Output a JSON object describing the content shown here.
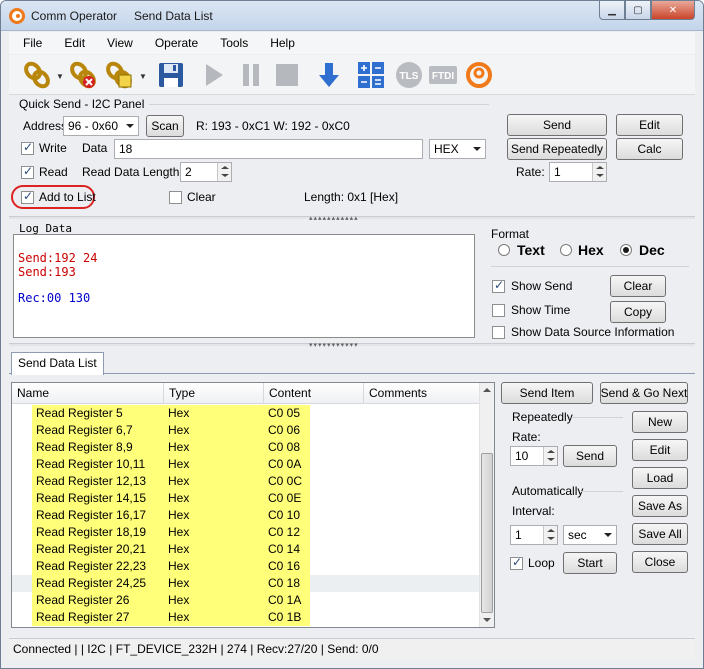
{
  "window": {
    "app_title": "Comm Operator",
    "doc_title": "Send Data List"
  },
  "menu": [
    "File",
    "Edit",
    "View",
    "Operate",
    "Tools",
    "Help"
  ],
  "toolbar": {
    "tls_label": "TLS",
    "ftdi_label": "FTDI"
  },
  "quick_send": {
    "group_title": "Quick Send - I2C Panel",
    "address_label": "Address",
    "address_value": "96 - 0x60",
    "scan_label": "Scan",
    "read_write_info": "R: 193 - 0xC1  W: 192 - 0xC0",
    "write_label": "Write",
    "data_label": "Data",
    "data_value": "18",
    "format_value": "HEX",
    "read_label": "Read",
    "read_length_label": "Read Data Length",
    "read_length_value": "2",
    "add_to_list_label": "Add to List",
    "clear_label": "Clear",
    "length_info": "Length: 0x1 [Hex]",
    "send_label": "Send",
    "send_repeatedly_label": "Send Repeatedly",
    "rate_label": "Rate:",
    "rate_value": "1",
    "edit_label": "Edit",
    "calc_label": "Calc",
    "write_checked": true,
    "read_checked": true,
    "add_to_list_checked": true,
    "clear_checked": false
  },
  "log": {
    "title": "Log Data",
    "lines": [
      {
        "text": "Send:192 24",
        "color": "#cc0000"
      },
      {
        "text": "Send:193",
        "color": "#cc0000"
      },
      {
        "text": "",
        "color": "#000000"
      },
      {
        "text": "Rec:00 130",
        "color": "#0000cc"
      }
    ]
  },
  "format": {
    "title": "Format",
    "options": [
      "Text",
      "Hex",
      "Dec"
    ],
    "selected": "Dec",
    "show_send_label": "Show Send",
    "show_time_label": "Show Time",
    "show_source_label": "Show Data Source Information",
    "clear_label": "Clear",
    "copy_label": "Copy"
  },
  "send_list": {
    "tab_label": "Send Data List",
    "columns": [
      "Name",
      "Type",
      "Content",
      "Comments"
    ],
    "rows": [
      {
        "name": "Read Register 5",
        "type": "Hex",
        "content": "C0 05",
        "comments": ""
      },
      {
        "name": "Read Register 6,7",
        "type": "Hex",
        "content": "C0 06",
        "comments": ""
      },
      {
        "name": "Read Register 8,9",
        "type": "Hex",
        "content": "C0 08",
        "comments": ""
      },
      {
        "name": "Read Register 10,11",
        "type": "Hex",
        "content": "C0 0A",
        "comments": ""
      },
      {
        "name": "Read Register 12,13",
        "type": "Hex",
        "content": "C0 0C",
        "comments": ""
      },
      {
        "name": "Read Register 14,15",
        "type": "Hex",
        "content": "C0 0E",
        "comments": ""
      },
      {
        "name": "Read Register 16,17",
        "type": "Hex",
        "content": "C0 10",
        "comments": ""
      },
      {
        "name": "Read Register 18,19",
        "type": "Hex",
        "content": "C0 12",
        "comments": ""
      },
      {
        "name": "Read Register 20,21",
        "type": "Hex",
        "content": "C0 14",
        "comments": ""
      },
      {
        "name": "Read Register 22,23",
        "type": "Hex",
        "content": "C0 16",
        "comments": ""
      },
      {
        "name": "Read Register 24,25",
        "type": "Hex",
        "content": "C0 18",
        "comments": ""
      },
      {
        "name": "Read Register 26",
        "type": "Hex",
        "content": "C0 1A",
        "comments": ""
      },
      {
        "name": "Read Register 27",
        "type": "Hex",
        "content": "C0 1B",
        "comments": ""
      }
    ],
    "selected_row": 10,
    "send_item_label": "Send Item",
    "send_go_next_label": "Send & Go Next",
    "repeatedly_title": "Repeatedly",
    "rate_label": "Rate:",
    "rate_value": "10",
    "send_label": "Send",
    "automatically_title": "Automatically",
    "interval_label": "Interval:",
    "interval_value": "1",
    "interval_unit": "sec",
    "loop_label": "Loop",
    "start_label": "Start",
    "new_label": "New",
    "edit_label": "Edit",
    "load_label": "Load",
    "save_as_label": "Save As",
    "save_all_label": "Save All",
    "close_label": "Close"
  },
  "status": {
    "text": "Connected |  | I2C | FT_DEVICE_232H | 274 | Recv:27/20 | Send: 0/0"
  },
  "colors": {
    "highlight": "#ffff7a",
    "log_send": "#cc0000",
    "log_recv": "#0000cc"
  }
}
